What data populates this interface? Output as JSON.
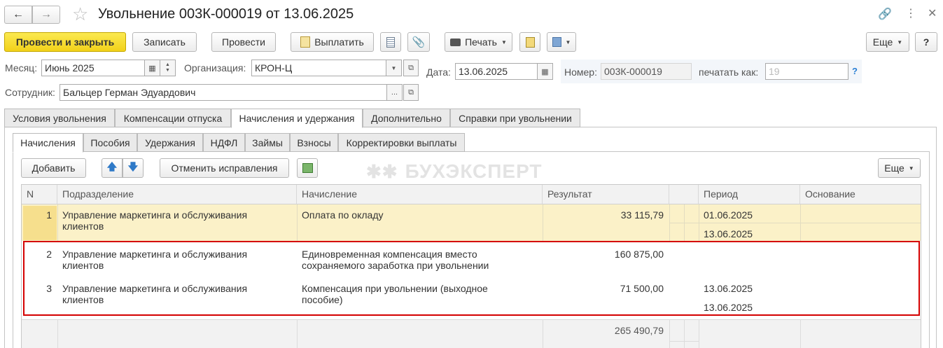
{
  "window": {
    "title": "Увольнение 003К-000019 от 13.06.2025"
  },
  "toolbar": {
    "post_close": "Провести и закрыть",
    "save": "Записать",
    "post": "Провести",
    "pay": "Выплатить",
    "print": "Печать",
    "more": "Еще",
    "help": "?"
  },
  "header": {
    "month_label": "Месяц:",
    "month_value": "Июнь 2025",
    "org_label": "Организация:",
    "org_value": "КРОН-Ц",
    "date_label": "Дата:",
    "date_value": "13.06.2025",
    "number_label": "Номер:",
    "number_value": "003К-000019",
    "print_as_label": "печатать как:",
    "print_as_placeholder": "19",
    "print_as_help": "?",
    "employee_label": "Сотрудник:",
    "employee_value": "Бальцер Герман Эдуардович"
  },
  "tabs": [
    "Условия увольнения",
    "Компенсации отпуска",
    "Начисления и удержания",
    "Дополнительно",
    "Справки при увольнении"
  ],
  "subtabs": [
    "Начисления",
    "Пособия",
    "Удержания",
    "НДФЛ",
    "Займы",
    "Взносы",
    "Корректировки выплаты"
  ],
  "grid_toolbar": {
    "add": "Добавить",
    "cancel_corrections": "Отменить исправления",
    "more": "Еще"
  },
  "watermark": "БУХЭКСПЕРТ",
  "table": {
    "columns": [
      "N",
      "Подразделение",
      "Начисление",
      "Результат",
      "",
      "Период",
      "Основание"
    ],
    "rows": [
      {
        "n": "1",
        "dept_line1": "Управление маркетинга и обслуживания",
        "dept_line2": "клиентов",
        "accrual_line1": "Оплата по окладу",
        "accrual_line2": "",
        "result": "33 115,79",
        "period_from": "01.06.2025",
        "period_to": "13.06.2025"
      },
      {
        "n": "2",
        "dept_line1": "Управление маркетинга и обслуживания",
        "dept_line2": "клиентов",
        "accrual_line1": "Единовременная компенсация вместо",
        "accrual_line2": "сохраняемого заработка при увольнении",
        "result": "160 875,00",
        "period_from": "",
        "period_to": ""
      },
      {
        "n": "3",
        "dept_line1": "Управление маркетинга и обслуживания",
        "dept_line2": "клиентов",
        "accrual_line1": "Компенсация при увольнении (выходное",
        "accrual_line2": "пособие)",
        "result": "71 500,00",
        "period_from": "13.06.2025",
        "period_to": "13.06.2025"
      }
    ],
    "total": "265 490,79"
  },
  "colors": {
    "primary_button": "#f2d11a",
    "selected_row": "#fbf1c8",
    "highlight_frame": "#d40000",
    "help_link": "#2a7fd4"
  }
}
